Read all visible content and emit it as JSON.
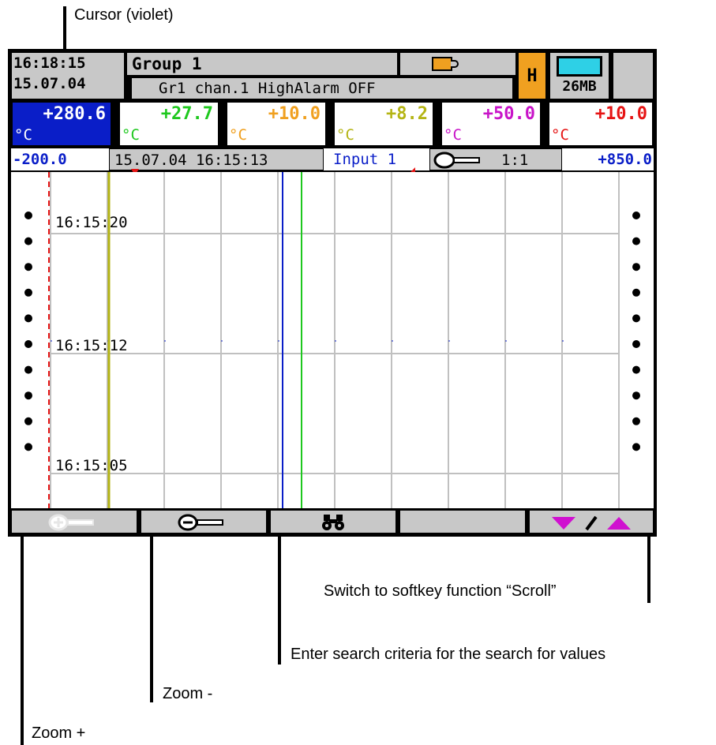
{
  "annotations": {
    "cursor": "Cursor (violet)",
    "scroll": "Switch to softkey function “Scroll”",
    "search": "Enter search criteria for the search for values",
    "zoom_minus": "Zoom -",
    "zoom_plus": "Zoom +"
  },
  "header": {
    "time": "16:18:15",
    "date": "15.07.04",
    "group": "Group 1",
    "alarm_message": "Gr1 chan.1 HighAlarm OFF",
    "mode_badge": "H",
    "memory": "26MB",
    "battery_icon": "battery-icon",
    "memory_icon": "memory-card-icon"
  },
  "channels": [
    {
      "value": "+280.6",
      "unit": "°C",
      "color": "#0a1ec8",
      "selected": true
    },
    {
      "value": "+27.7",
      "unit": "°C",
      "color": "#1ec81e",
      "selected": false
    },
    {
      "value": "+10.0",
      "unit": "°C",
      "color": "#f0a020",
      "selected": false
    },
    {
      "value": "+8.2",
      "unit": "°C",
      "color": "#b4b414",
      "selected": false
    },
    {
      "value": "+50.0",
      "unit": "°C",
      "color": "#c814c8",
      "selected": false
    },
    {
      "value": "+10.0",
      "unit": "°C",
      "color": "#e61414",
      "selected": false
    }
  ],
  "scale": {
    "min": "-200.0",
    "timestamp": "15.07.04 16:15:13",
    "input": "Input 1",
    "zoom_ratio": "1:1",
    "max": "+850.0"
  },
  "chart": {
    "time_labels": [
      "16:15:20",
      "16:15:12",
      "16:15:05"
    ],
    "colors": {
      "grid": "#c0c0c0",
      "cursor": "#e61414",
      "blue": "#0a1ec8",
      "green": "#1ec81e",
      "yellow": "#b4b414"
    }
  },
  "softkeys": [
    {
      "name": "zoom-plus",
      "icon": "zoom-in-icon"
    },
    {
      "name": "zoom-minus",
      "icon": "zoom-out-icon"
    },
    {
      "name": "search",
      "icon": "binoculars-icon"
    },
    {
      "name": "empty",
      "icon": ""
    },
    {
      "name": "scroll",
      "icon": "scroll-arrows-icon"
    }
  ]
}
